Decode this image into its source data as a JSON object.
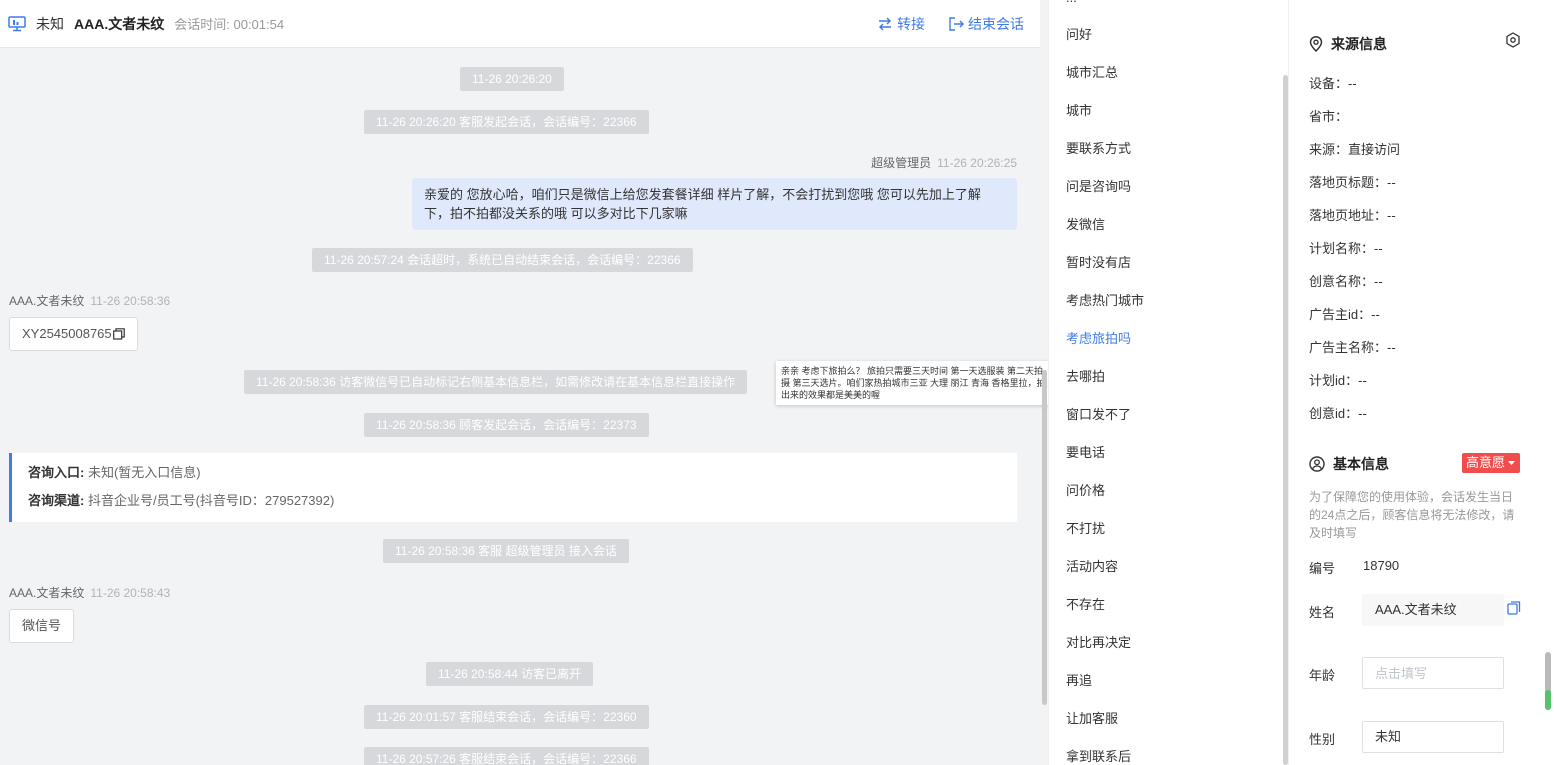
{
  "header": {
    "source": "未知",
    "visitor_name": "AAA.文者未纹",
    "session_time_label": "会话时间:",
    "session_time": "00:01:54",
    "transfer_label": "转接",
    "end_label": "结束会话"
  },
  "messages": {
    "sys1": "11-26 20:26:20",
    "sys2": "11-26 20:26:20 客服发起会话，会话编号：22366",
    "agent_name": "超级管理员",
    "agent_time": "11-26 20:26:25",
    "agent_text": "亲爱的 您放心哈，咱们只是微信上给您发套餐详细 样片了解，不会打扰到您哦 您可以先加上了解下，拍不拍都没关系的哦 可以多对比下几家嘛",
    "sys3": "11-26 20:57:24 会话超时，系统已自动结束会话，会话编号：22366",
    "visitor1_name": "AAA.文者未纹",
    "visitor1_time": "11-26 20:58:36",
    "visitor1_text": "XY2545008765",
    "sys4": "11-26 20:58:36 访客微信号已自动标记右侧基本信息栏，如需修改请在基本信息栏直接操作",
    "sys5": "11-26 20:58:36 顾客发起会话，会话编号：22373",
    "entry_label": "咨询入口:",
    "entry_value": "未知(暂无入口信息)",
    "channel_label": "咨询渠道:",
    "channel_value": "抖音企业号/员工号(抖音号ID：279527392)",
    "sys6": "11-26 20:58:36 客服 超级管理员 接入会话",
    "visitor2_name": "AAA.文者未纹",
    "visitor2_time": "11-26 20:58:43",
    "visitor2_text": "微信号",
    "sys7": "11-26 20:58:44 访客已离开",
    "sys8": "11-26 20:01:57 客服结束会话，会话编号：22360",
    "sys9": "11-26 20:57:26 客服结束会话，会话编号：22366",
    "tooltip": "亲亲 考虑下旅拍么？ 旅拍只需要三天时间 第一天选服装 第二天拍摄 第三天选片。咱们家热拍城市三亚 大理 丽江 青海 香格里拉，拍出来的效果都是美美的喔"
  },
  "quick_replies": {
    "top_cut": "...",
    "items": [
      "问好",
      "城市汇总",
      "城市",
      "要联系方式",
      "问是咨询吗",
      "发微信",
      "暂时没有店",
      "考虑热门城市",
      "考虑旅拍吗",
      "去哪拍",
      "窗口发不了",
      "要电话",
      "问价格",
      "不打扰",
      "活动内容",
      "不存在",
      "对比再决定",
      "再追",
      "让加客服",
      "拿到联系后"
    ]
  },
  "info": {
    "source_title": "来源信息",
    "device": "设备：--",
    "province": "省市：",
    "origin": "来源：直接访问",
    "landing_title": "落地页标题：--",
    "landing_url": "落地页地址：--",
    "plan_name": "计划名称：--",
    "creative_name": "创意名称：--",
    "advertiser_id": "广告主id：--",
    "advertiser_name": "广告主名称：--",
    "plan_id": "计划id：--",
    "creative_id": "创意id：--",
    "basic_title": "基本信息",
    "intent_badge": "高意愿",
    "note": "为了保障您的使用体验，会话发生当日的24点之后，顾客信息将无法修改，请及时填写",
    "id_label": "编号",
    "id_value": "18790",
    "name_label": "姓名",
    "name_value": "AAA.文者未纹",
    "age_label": "年龄",
    "age_placeholder": "点击填写",
    "gender_label": "性别",
    "gender_value": "未知"
  },
  "colors": {
    "accent": "#3d7be8",
    "agent_bubble": "#dfe9fb",
    "system_pill": "#d6d8db",
    "badge": "#f24d4d"
  }
}
